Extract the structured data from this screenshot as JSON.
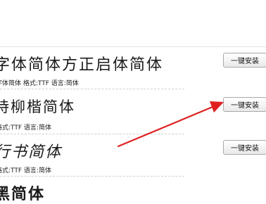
{
  "fonts": [
    {
      "name": "字体简体方正启体简体",
      "meta": "字体简体 格式:TTF 语言:简体",
      "button": "一键安装"
    },
    {
      "name": "诗柳楷简体",
      "meta": "格式:TTF 语言:简体",
      "button": "一键安装"
    },
    {
      "name": "行书简体",
      "meta": "格式:TTF 语言:简体",
      "button": "一键安装"
    },
    {
      "name": "黑简体"
    }
  ],
  "annotation_color": "#e02020"
}
